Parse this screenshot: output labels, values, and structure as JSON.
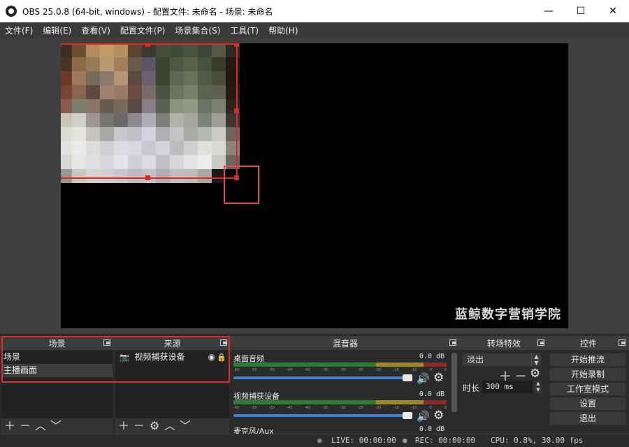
{
  "window": {
    "title": "OBS 25.0.8 (64-bit, windows) - 配置文件: 未命名 - 场景: 未命名",
    "minimize": "—",
    "maximize": "☐",
    "close": "✕"
  },
  "menu": [
    "文件(F)",
    "编辑(E)",
    "查看(V)",
    "配置文件(P)",
    "场景集合(S)",
    "工具(T)",
    "帮助(H)"
  ],
  "preview": {
    "watermark": "蓝鲸数字营销学院"
  },
  "scenes": {
    "title": "场景",
    "items": [
      "场景",
      "主播画面"
    ],
    "selected_index": 1
  },
  "sources": {
    "title": "来源",
    "items": [
      {
        "label": "视频捕获设备",
        "icon": "camera-icon",
        "visible": true,
        "locked": false
      }
    ]
  },
  "mixer": {
    "title": "混音器",
    "channels": [
      {
        "name": "桌面音频",
        "db": "0.0 dB",
        "volume_fraction": 1.0
      },
      {
        "name": "视频捕获设备",
        "db": "0.0 dB",
        "volume_fraction": 1.0
      },
      {
        "name": "麦克风/Aux",
        "db": "0.0 dB",
        "volume_fraction": 1.0
      }
    ],
    "ticks": [
      "-60",
      "-55",
      "-50",
      "-45",
      "-40",
      "-35",
      "-30",
      "-25",
      "-20",
      "-15",
      "-10",
      "-5",
      "0"
    ]
  },
  "transitions": {
    "title": "转场特效",
    "selected": "淡出",
    "duration_label": "时长",
    "duration_value": "300 ms"
  },
  "controls": {
    "title": "控件",
    "buttons": [
      "开始推流",
      "开始录制",
      "工作室模式",
      "设置",
      "退出"
    ]
  },
  "status": {
    "live": "LIVE: 00:00:00",
    "rec": "REC: 00:00:00",
    "cpu": "CPU: 0.8%, 30.00 fps"
  },
  "colors": {
    "selection_red": "#e32727",
    "accent_blue": "#3b82d6"
  }
}
